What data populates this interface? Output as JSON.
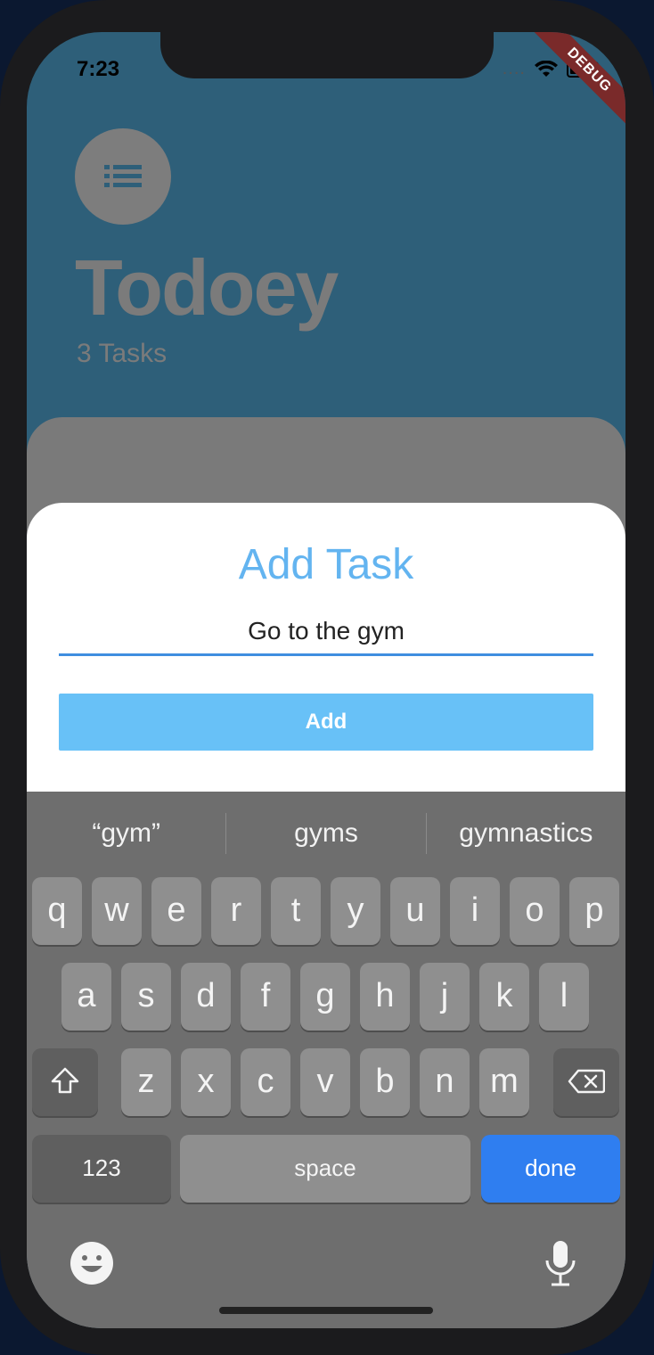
{
  "status_bar": {
    "time": "7:23",
    "signal": "....",
    "debug_label": "DEBUG"
  },
  "app": {
    "title": "Todoey",
    "task_count": "3 Tasks",
    "icon": "list-icon"
  },
  "sheet": {
    "title": "Add Task",
    "input_value": "Go to the gym",
    "add_label": "Add",
    "accent_color": "#63b4f0",
    "button_color": "#68c1f7"
  },
  "keyboard": {
    "suggestions": [
      "“gym”",
      "gyms",
      "gymnastics"
    ],
    "row1": [
      "q",
      "w",
      "e",
      "r",
      "t",
      "y",
      "u",
      "i",
      "o",
      "p"
    ],
    "row2": [
      "a",
      "s",
      "d",
      "f",
      "g",
      "h",
      "j",
      "k",
      "l"
    ],
    "row3": [
      "z",
      "x",
      "c",
      "v",
      "b",
      "n",
      "m"
    ],
    "numbers_label": "123",
    "space_label": "space",
    "done_label": "done",
    "done_color": "#2f7ef0"
  }
}
